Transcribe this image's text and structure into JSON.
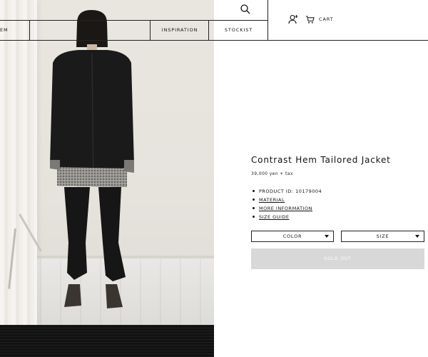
{
  "nav": {
    "items": [
      "EM",
      "INSPIRATION",
      "STOCKIST"
    ],
    "cart_label": "CART"
  },
  "icons": {
    "search": "search-icon",
    "user": "user-plus-icon",
    "cart": "cart-icon",
    "dropdown": "chevron-down-icon"
  },
  "product": {
    "title": "Contrast Hem Tailored Jacket",
    "price": "39,000 yen + tax",
    "details": {
      "product_id": "PRODUCT ID: 10179004",
      "material": "MATERIAL",
      "more_info": "MORE INFORMATION",
      "size_guide": "SIZE GUIDE"
    },
    "color_select": "COLOR",
    "size_select": "SIZE",
    "sold_out": "SOLD OUT"
  },
  "colors": {
    "text": "#111111",
    "border": "#222222",
    "sold_out_bg": "#d8d8d8",
    "sold_out_text": "#ffffff"
  }
}
